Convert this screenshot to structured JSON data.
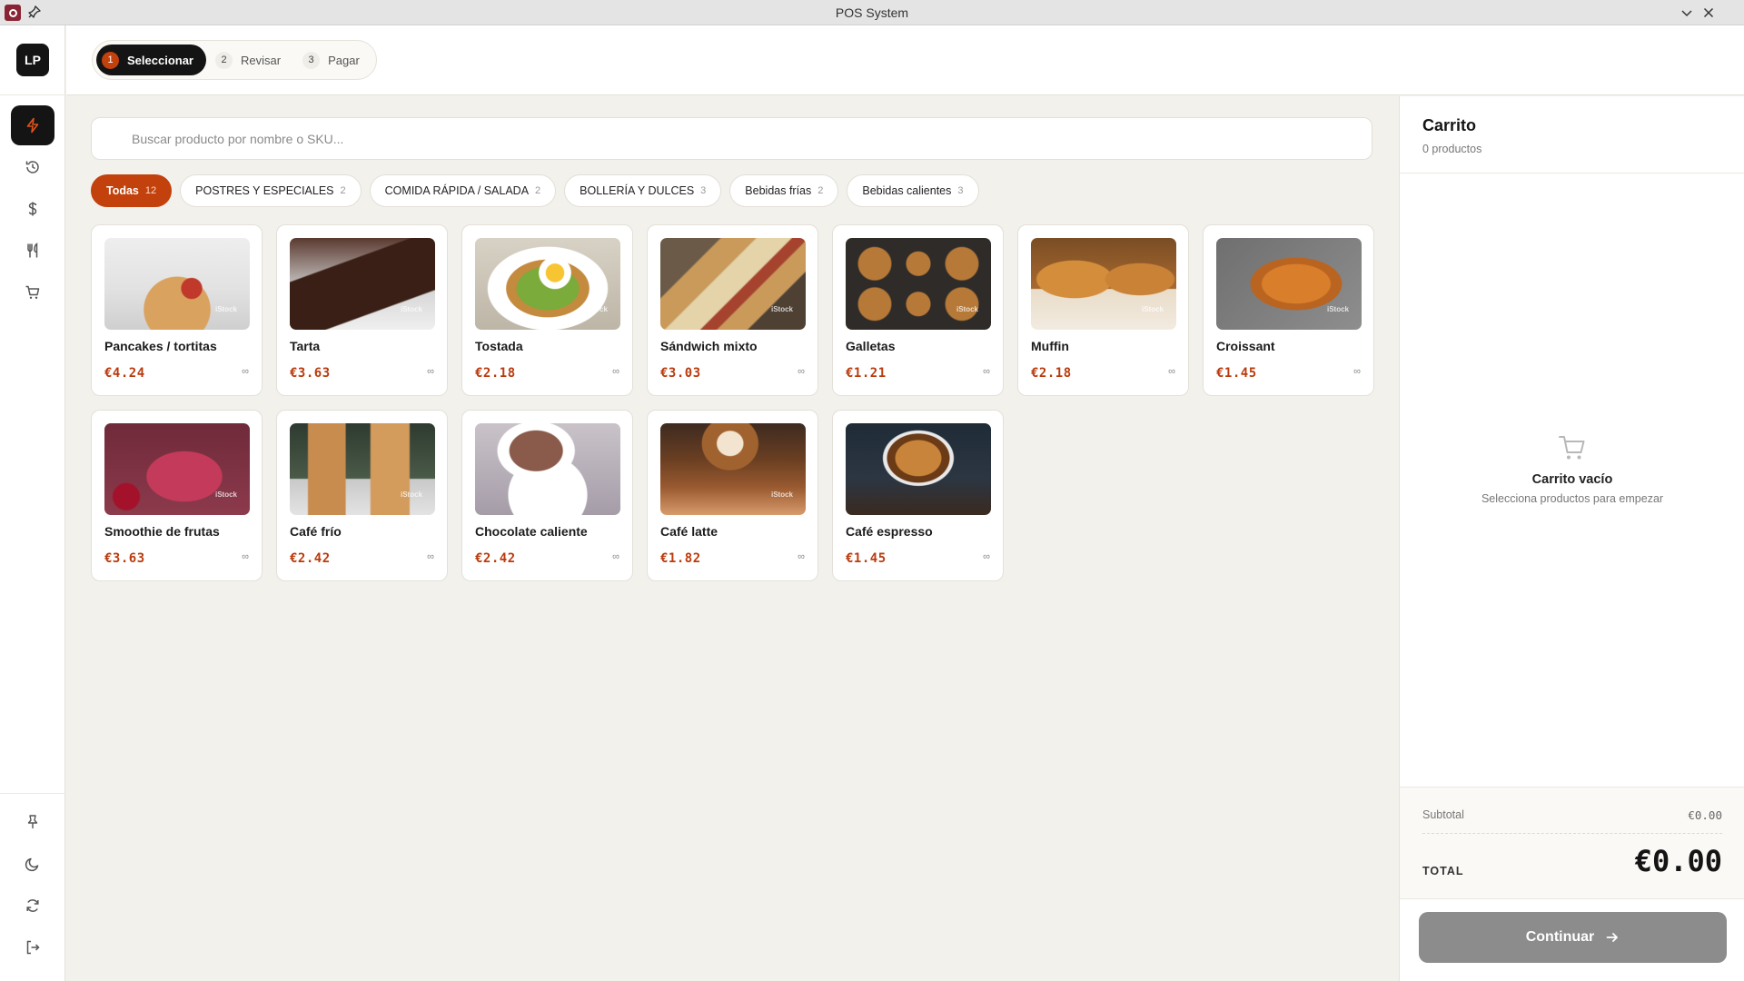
{
  "window": {
    "title": "POS System"
  },
  "rail": {
    "avatar": "LP"
  },
  "stepper": [
    {
      "num": "1",
      "label": "Seleccionar",
      "active": true
    },
    {
      "num": "2",
      "label": "Revisar"
    },
    {
      "num": "3",
      "label": "Pagar"
    }
  ],
  "search": {
    "placeholder": "Buscar producto por nombre o SKU...",
    "value": ""
  },
  "categories": [
    {
      "label": "Todas",
      "count": "12",
      "active": true
    },
    {
      "label": "POSTRES Y ESPECIALES",
      "count": "2"
    },
    {
      "label": "COMIDA RÁPIDA / SALADA",
      "count": "2"
    },
    {
      "label": "BOLLERÍA Y DULCES",
      "count": "3"
    },
    {
      "label": "Bebidas frías",
      "count": "2"
    },
    {
      "label": "Bebidas calientes",
      "count": "3"
    }
  ],
  "products": [
    {
      "name": "Pancakes / tortitas",
      "price": "€4.24",
      "stock": "∞",
      "image_watermark": "iStock"
    },
    {
      "name": "Tarta",
      "price": "€3.63",
      "stock": "∞",
      "image_watermark": "iStock"
    },
    {
      "name": "Tostada",
      "price": "€2.18",
      "stock": "∞",
      "image_watermark": "iStock"
    },
    {
      "name": "Sándwich mixto",
      "price": "€3.03",
      "stock": "∞",
      "image_watermark": "iStock"
    },
    {
      "name": "Galletas",
      "price": "€1.21",
      "stock": "∞",
      "image_watermark": "iStock"
    },
    {
      "name": "Muffin",
      "price": "€2.18",
      "stock": "∞",
      "image_watermark": "iStock"
    },
    {
      "name": "Croissant",
      "price": "€1.45",
      "stock": "∞",
      "image_watermark": "iStock"
    },
    {
      "name": "Smoothie de frutas",
      "price": "€3.63",
      "stock": "∞",
      "image_watermark": "iStock"
    },
    {
      "name": "Café frío",
      "price": "€2.42",
      "stock": "∞",
      "image_watermark": "iStock"
    },
    {
      "name": "Chocolate caliente",
      "price": "€2.42",
      "stock": "∞",
      "image_watermark": ""
    },
    {
      "name": "Café latte",
      "price": "€1.82",
      "stock": "∞",
      "image_watermark": "iStock"
    },
    {
      "name": "Café espresso",
      "price": "€1.45",
      "stock": "∞",
      "image_watermark": ""
    }
  ],
  "cart": {
    "title": "Carrito",
    "count": "0 productos",
    "empty_title": "Carrito vacío",
    "empty_sub": "Selecciona productos para empezar",
    "subtotal_label": "Subtotal",
    "subtotal_value": "€0.00",
    "total_label": "TOTAL",
    "total_value": "€0.00",
    "continue_label": "Continuar"
  },
  "colors": {
    "accent": "#c2410c",
    "price": "#b93b0d",
    "dark": "#141414",
    "background": "#f3f1ec",
    "button_disabled": "#8c8c8c"
  }
}
